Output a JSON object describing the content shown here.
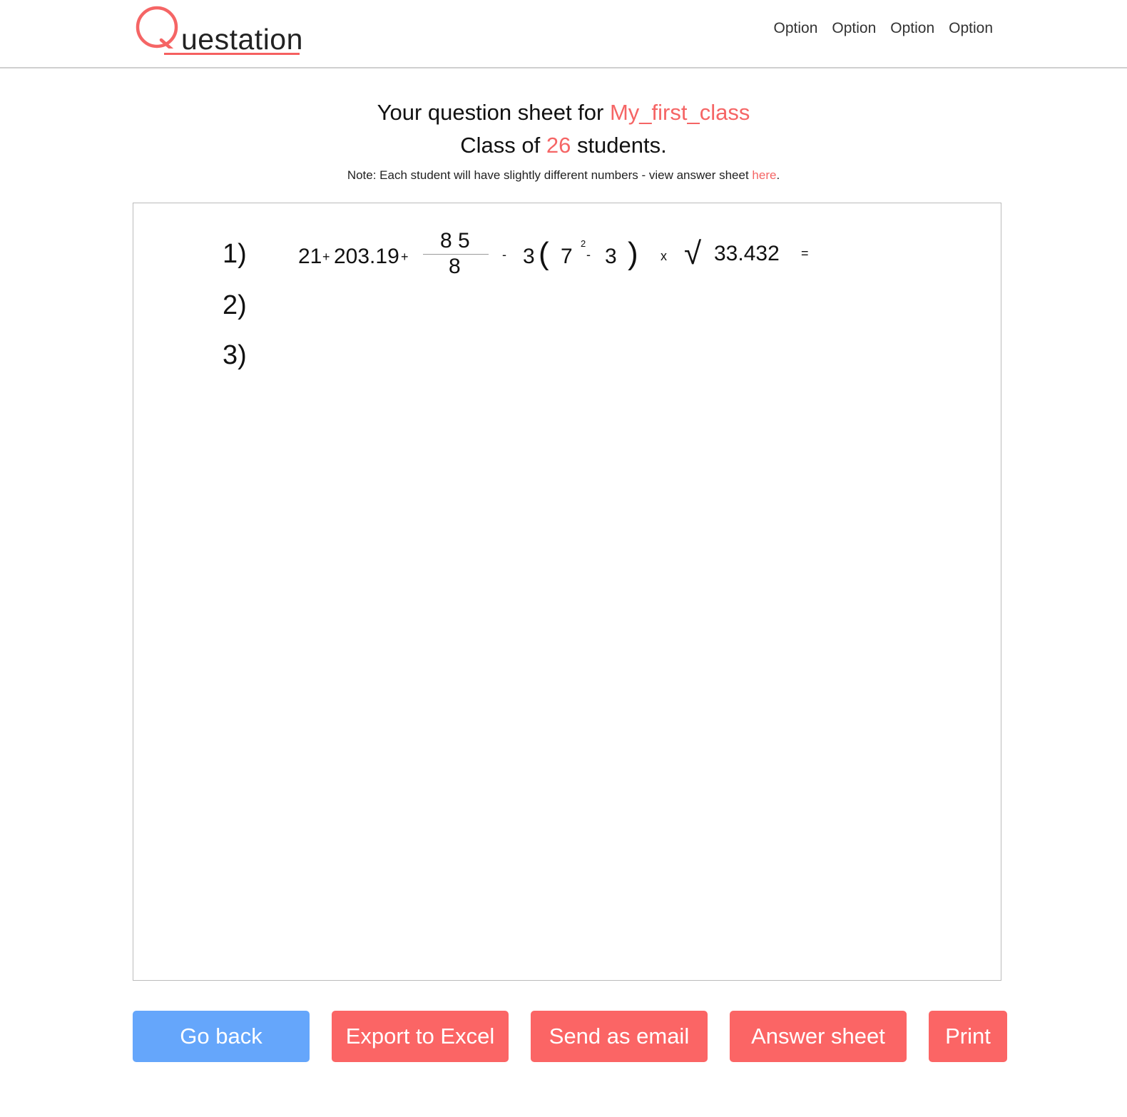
{
  "app": {
    "logo_q": "Q",
    "logo_rest": "uestation"
  },
  "nav": {
    "items": [
      {
        "label": "Option"
      },
      {
        "label": "Option"
      },
      {
        "label": "Option"
      },
      {
        "label": "Option"
      }
    ]
  },
  "heading": {
    "title_prefix": "Your question sheet for ",
    "class_name": "My_first_class",
    "class_prefix": "Class of ",
    "student_count": "26",
    "class_suffix": " students.",
    "note_prefix": "Note: Each student will have slightly different numbers - view answer sheet ",
    "note_link": "here",
    "note_suffix": "."
  },
  "questions": {
    "q1": {
      "number": "1)",
      "expression": {
        "term1": "21",
        "op1": "+",
        "term2": "203.19",
        "op2": "+",
        "numerator": "8 5",
        "denominator": "8",
        "op3": "-",
        "coef": "3",
        "lparen": "(",
        "base": "7",
        "exponent": "2",
        "op4": "-",
        "term3": "3",
        "rparen": ")",
        "op5": "x",
        "sqrt": "√",
        "radicand": "33.432",
        "equals": "="
      }
    },
    "q2": {
      "number": "2)"
    },
    "q3": {
      "number": "3)"
    }
  },
  "buttons": {
    "go_back": "Go back",
    "export_excel": "Export to Excel",
    "send_email": "Send as email",
    "answer_sheet": "Answer sheet",
    "print": "Print"
  },
  "colors": {
    "accent": "#f56565",
    "primary_blue": "#65a6fb",
    "button_red": "#fb6565"
  }
}
